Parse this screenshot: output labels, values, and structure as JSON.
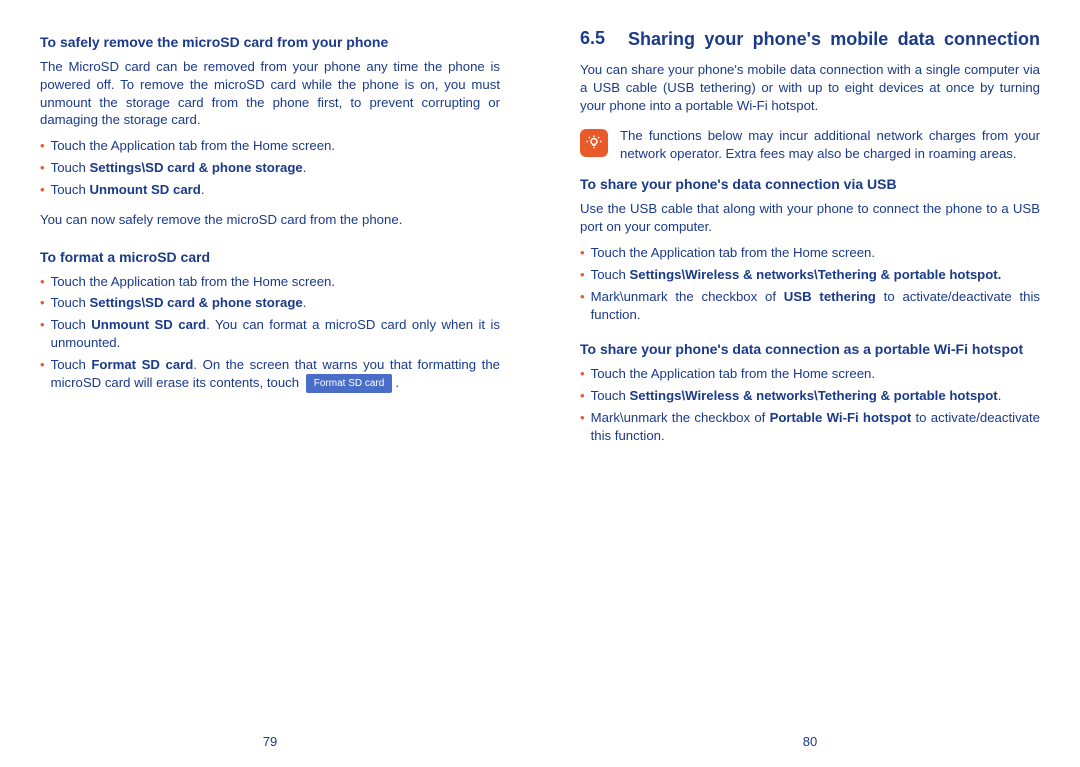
{
  "left": {
    "pageNum": "79",
    "h1": "To safely remove the microSD card from your phone",
    "p1": "The MicroSD card can be removed from your phone any time the phone is powered off. To remove the microSD card while the phone is on, you must unmount the storage card from the phone first, to prevent corrupting or damaging the storage card.",
    "b1": "Touch the Application tab from the Home screen.",
    "b2a": "Touch ",
    "b2b": "Settings\\SD card & phone storage",
    "b2c": ".",
    "b3a": "Touch ",
    "b3b": "Unmount SD card",
    "b3c": ".",
    "p2": "You can now safely remove the microSD card from the phone.",
    "h2": "To format a microSD card",
    "c1": "Touch the Application tab from the Home screen.",
    "c2a": "Touch ",
    "c2b": "Settings\\SD card & phone storage",
    "c2c": ".",
    "c3a": "Touch ",
    "c3b": "Unmount SD card",
    "c3c": ". You can format a microSD card only when it is unmounted.",
    "c4a": "Touch ",
    "c4b": "Format SD card",
    "c4c": ". On the screen that warns you that formatting the microSD card will erase its contents, touch ",
    "btn": "Format SD card",
    "c4d": "."
  },
  "right": {
    "pageNum": "80",
    "secNum": "6.5",
    "secTitle": "Sharing your phone's mobile data connection",
    "p1": "You can share your phone's mobile data connection with a single computer via a USB cable (USB tethering) or with up to eight devices at once by turning your phone into a portable Wi-Fi hotspot.",
    "note": "The functions below may incur additional network charges from your network operator. Extra fees may also be charged in roaming areas.",
    "h1": "To share your phone's data connection via USB",
    "p2": "Use the USB cable that along with your phone to connect the phone to a USB port on your computer.",
    "b1": "Touch the Application tab from the Home screen.",
    "b2a": "Touch ",
    "b2b": "Settings\\Wireless & networks\\Tethering & portable hotspot.",
    "b3a": "Mark\\unmark the checkbox of ",
    "b3b": "USB tethering",
    "b3c": " to activate/deactivate this function.",
    "h2": "To share your phone's data connection as a portable Wi-Fi hotspot",
    "c1": "Touch the Application tab from the Home screen.",
    "c2a": "Touch ",
    "c2b": "Settings\\Wireless & networks\\Tethering & portable hotspot",
    "c2c": ".",
    "c3a": "Mark\\unmark the checkbox of ",
    "c3b": "Portable Wi-Fi hotspot",
    "c3c": " to activate/deactivate this function."
  }
}
